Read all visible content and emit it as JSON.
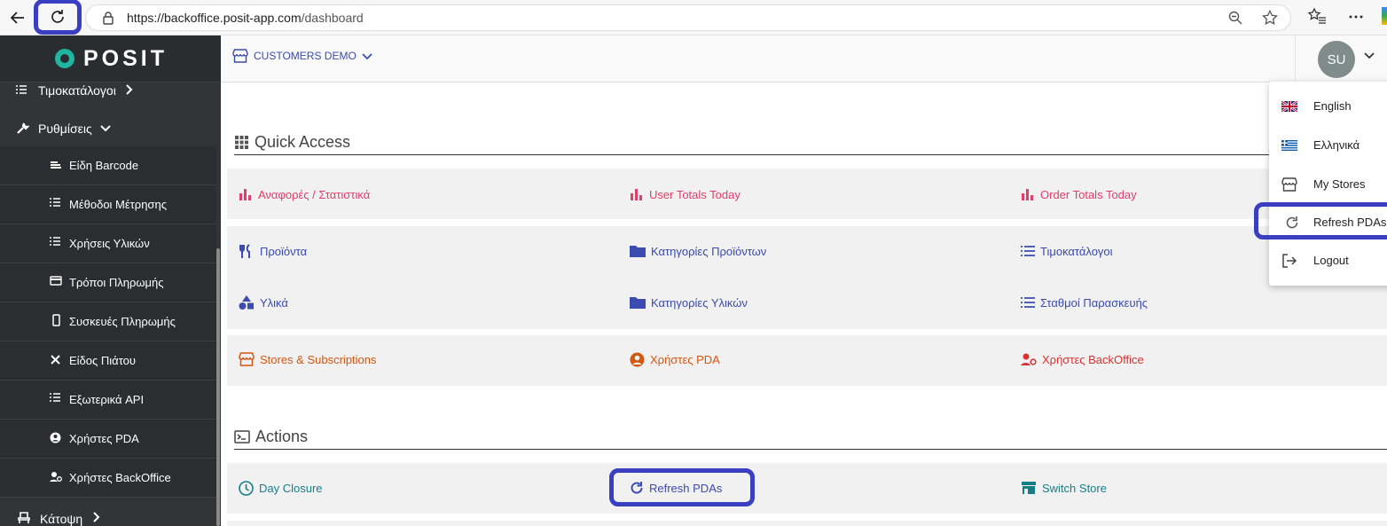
{
  "browser": {
    "url_host": "https://backoffice.posit-app.com",
    "url_path": "/dashboard"
  },
  "sidebar": {
    "logo": "POSIT",
    "top_items": [
      {
        "label": "Τιμοκατάλογοι",
        "icon": "list-icon",
        "chevron": "right"
      },
      {
        "label": "Ρυθμίσεις",
        "icon": "wrench-icon",
        "chevron": "down"
      }
    ],
    "sub_items": [
      {
        "label": "Είδη Barcode",
        "icon": "barcode-icon"
      },
      {
        "label": "Μέθοδοι Μέτρησης",
        "icon": "list-icon"
      },
      {
        "label": "Χρήσεις Υλικών",
        "icon": "list-icon"
      },
      {
        "label": "Τρόποι Πληρωμής",
        "icon": "credit-card-icon"
      },
      {
        "label": "Συσκευές Πληρωμής",
        "icon": "mobile-icon"
      },
      {
        "label": "Είδος Πιάτου",
        "icon": "utensils-icon"
      },
      {
        "label": "Εξωτερικά API",
        "icon": "list-icon"
      },
      {
        "label": "Χρήστες PDA",
        "icon": "user-circle-icon"
      },
      {
        "label": "Χρήστες BackOffice",
        "icon": "user-cog-icon"
      }
    ],
    "bottom_item": {
      "label": "Κάτοψη",
      "icon": "chair-icon",
      "chevron": "right"
    }
  },
  "header": {
    "store_name": "CUSTOMERS DEMO",
    "avatar_initials": "SU"
  },
  "quick_access": {
    "title": "Quick Access",
    "rows": [
      [
        "Αναφορές / Στατιστικά",
        "User Totals Today",
        "Order Totals Today"
      ],
      [
        "Προϊόντα",
        "Κατηγορίες Προϊόντων",
        "Τιμοκατάλογοι"
      ],
      [
        "Υλικά",
        "Κατηγορίες Υλικών",
        "Σταθμοί Παρασκευής"
      ],
      [
        "Stores & Subscriptions",
        "Χρήστες PDA",
        "Χρήστες BackOffice"
      ]
    ]
  },
  "actions": {
    "title": "Actions",
    "items": [
      "Day Closure",
      "Refresh PDAs",
      "Switch Store"
    ]
  },
  "user_menu": {
    "items": [
      "English",
      "Ελληνικά",
      "My Stores",
      "Refresh PDAs",
      "Logout"
    ]
  },
  "colors": {
    "sidebar_bg": "#323538",
    "accent_blue": "#3b4bb0",
    "pink": "#e33d6e",
    "orange": "#d4560f",
    "red": "#d63333",
    "teal": "#157f87",
    "highlight": "#3a3fc1",
    "logo_green": "#1fb5a0"
  }
}
